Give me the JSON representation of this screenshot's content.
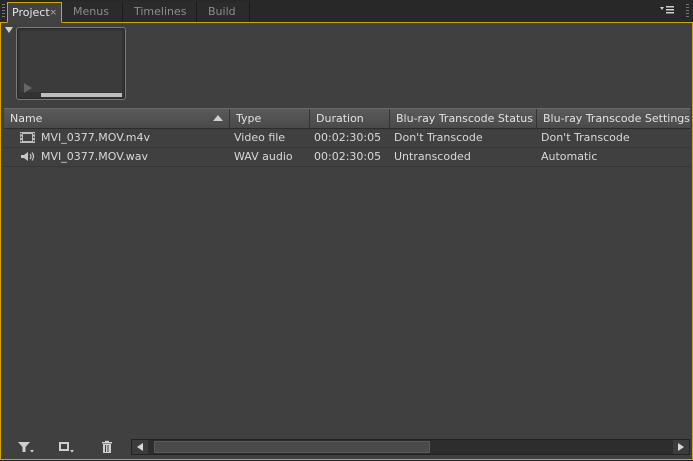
{
  "tabs": [
    {
      "label": "Project",
      "active": true,
      "close_glyph": "×"
    },
    {
      "label": "Menus",
      "active": false
    },
    {
      "label": "Timelines",
      "active": false
    },
    {
      "label": "Build",
      "active": false
    }
  ],
  "panel_menu_icon": "panel-menu-icon",
  "table": {
    "columns": [
      "Name",
      "Type",
      "Duration",
      "Blu-ray Transcode Status",
      "Blu-ray Transcode Settings"
    ],
    "rows": [
      {
        "icon": "video-file-icon",
        "name": "MVI_0377.MOV.m4v",
        "type": "Video file",
        "duration": "00:02:30:05",
        "status": "Don't Transcode",
        "settings": "Don't Transcode"
      },
      {
        "icon": "audio-file-icon",
        "name": "MVI_0377.MOV.wav",
        "type": "WAV audio",
        "duration": "00:02:30:05",
        "status": "Untranscoded",
        "settings": "Automatic"
      }
    ]
  },
  "toolbar": {
    "filter_icon": "filter-icon",
    "new_item_icon": "new-item-icon",
    "delete_icon": "trash-icon"
  },
  "colors": {
    "accent": "#d4a400",
    "panel_bg": "#404040",
    "header_bg": "#525252",
    "text": "#d8d8d8"
  }
}
